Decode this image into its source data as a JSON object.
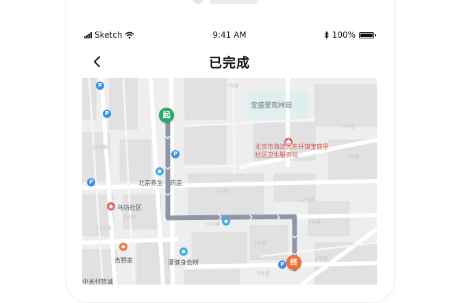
{
  "status_bar": {
    "carrier": "Sketch",
    "time": "9:41 AM",
    "battery": "100%"
  },
  "nav": {
    "back_icon": "chevron-left-icon",
    "title": "已完成"
  },
  "map": {
    "park_label": "宝盛里观林园",
    "poi_health_center": "北京市海淀区东升镇宝盛里社区卫生服务站",
    "poi_shop": "北京养生",
    "poi_shop_tail": "药店",
    "poi_community": "马坊社区",
    "poi_jiyejia": "吉野家",
    "poi_gym": "潭健身会所",
    "poi_bottom_left": "中关村智诚",
    "building_labels": [
      "1号楼",
      "2号楼",
      "8号楼",
      "2号楼",
      "13号楼",
      "1号楼",
      "4号楼",
      "3号楼",
      "9号楼",
      "10号楼",
      "15号楼",
      "8号楼",
      "2号楼"
    ],
    "start_label": "起",
    "end_label": "终",
    "parking_label": "P",
    "route_color": "#8e96a8",
    "start_color": "#27a96a",
    "end_color": "#f07033",
    "parking_color": "#3a8ee6"
  }
}
